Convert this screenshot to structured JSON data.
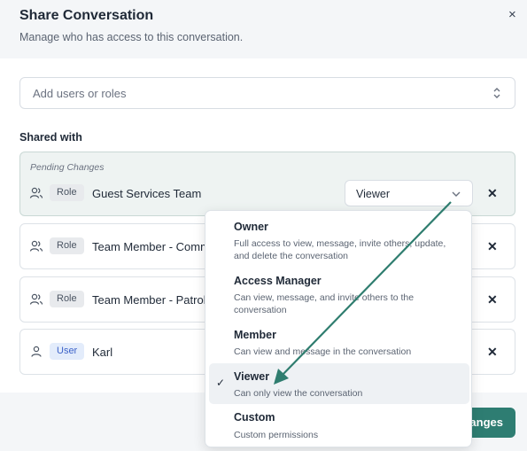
{
  "modal": {
    "title": "Share Conversation",
    "subtitle": "Manage who has access to this conversation.",
    "close_icon": "×"
  },
  "add_field": {
    "placeholder": "Add users or roles"
  },
  "shared_with_label": "Shared with",
  "pending_label": "Pending Changes",
  "rows": [
    {
      "type_label": "Role",
      "name": "Guest Services Team",
      "icon": "people-icon"
    },
    {
      "type_label": "Role",
      "name": "Team Member - Commun",
      "icon": "people-icon"
    },
    {
      "type_label": "Role",
      "name": "Team Member - Patrol",
      "icon": "people-icon"
    },
    {
      "type_label": "User",
      "name": "Karl",
      "icon": "person-icon"
    }
  ],
  "remove_icon": "✕",
  "permission_select": {
    "value": "Viewer"
  },
  "dropdown": {
    "options": [
      {
        "title": "Owner",
        "desc": "Full access to view, message, invite others, update, and delete the conversation"
      },
      {
        "title": "Access Manager",
        "desc": "Can view, message, and invite others to the conversation"
      },
      {
        "title": "Member",
        "desc": "Can view and message in the conversation"
      },
      {
        "title": "Viewer",
        "desc": "Can only view the conversation"
      },
      {
        "title": "Custom",
        "desc": "Custom permissions"
      }
    ],
    "selected_index": 3,
    "check_icon": "✓"
  },
  "footer": {
    "save_label": "Changes"
  },
  "colors": {
    "accent": "#2e7d72",
    "annotation_arrow": "#2f7d6f"
  }
}
